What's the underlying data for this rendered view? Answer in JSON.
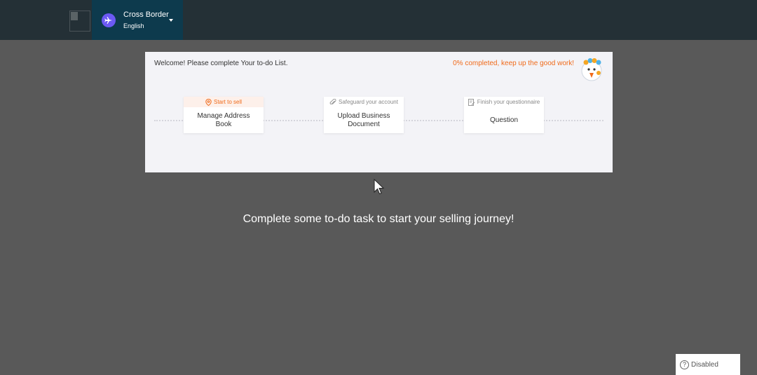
{
  "header": {
    "region": {
      "title": "Cross Border",
      "language": "English"
    }
  },
  "todo": {
    "welcome_text": "Welcome! Please complete Your to-do List.",
    "progress_text": "0% completed, keep up the good work!",
    "progress_percent": 0,
    "steps": [
      {
        "header": "Start to sell",
        "label": "Manage Address Book",
        "icon": "location-pin-icon",
        "active": true
      },
      {
        "header": "Safeguard your account",
        "label": "Upload Business Document",
        "icon": "paperclip-icon",
        "active": false
      },
      {
        "header": "Finish your questionnaire",
        "label": "Question",
        "icon": "edit-document-icon",
        "active": false
      }
    ]
  },
  "main": {
    "journey_text": "Complete some to-do task to start your selling journey!"
  },
  "status_badge": {
    "label": "Disabled",
    "icon": "help-circle-icon"
  },
  "colors": {
    "topbar": "#243036",
    "region_bg": "#0d3a4d",
    "region_icon": "#6b59f3",
    "accent_orange": "#f06a1a",
    "background": "#595959"
  }
}
